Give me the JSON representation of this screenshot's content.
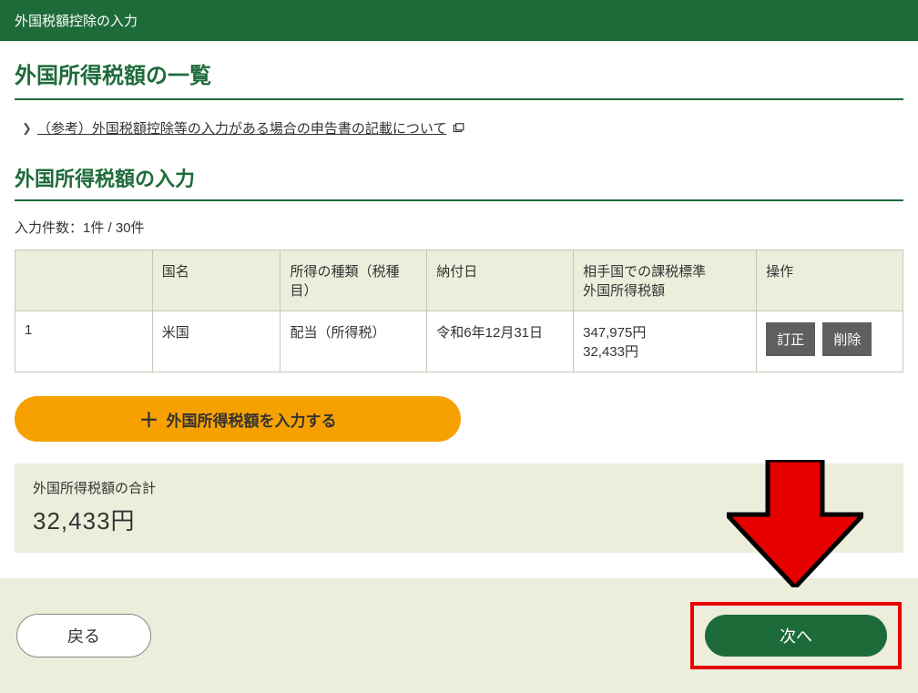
{
  "header": {
    "title": "外国税額控除の入力"
  },
  "page": {
    "title": "外国所得税額の一覧",
    "ref_link_label": "（参考）外国税額控除等の入力がある場合の申告書の記載について",
    "input_section_title": "外国所得税額の入力",
    "count_label": "入力件数：1件 / 30件"
  },
  "table": {
    "headers": {
      "num": "",
      "country": "国名",
      "type": "所得の種類（税種目）",
      "date": "納付日",
      "amount_l1": "相手国での課税標準",
      "amount_l2": "外国所得税額",
      "ops": "操作"
    },
    "rows": [
      {
        "num": "1",
        "country": "米国",
        "type": "配当（所得税）",
        "date": "令和6年12月31日",
        "amount1": "347,975円",
        "amount2": "32,433円"
      }
    ]
  },
  "buttons": {
    "add_label": "外国所得税額を入力する",
    "edit": "訂正",
    "delete": "削除",
    "back": "戻る",
    "next": "次へ"
  },
  "summary": {
    "label": "外国所得税額の合計",
    "value": "32,433円"
  }
}
